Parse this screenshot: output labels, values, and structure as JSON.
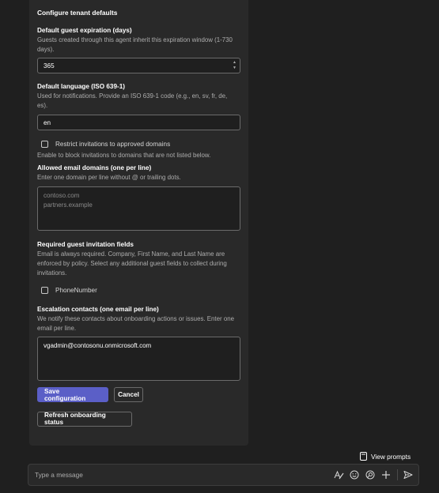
{
  "form": {
    "title": "Configure tenant defaults",
    "expiration": {
      "label": "Default guest expiration (days)",
      "help": "Guests created through this agent inherit this expiration window (1-730 days).",
      "value": "365"
    },
    "language": {
      "label": "Default language (ISO 639-1)",
      "help": "Used for notifications. Provide an ISO 639-1 code (e.g., en, sv, fr, de, es).",
      "value": "en"
    },
    "restrict": {
      "checkbox_label": "Restrict invitations to approved domains",
      "checked": false,
      "help": "Enable to block invitations to domains that are not listed below."
    },
    "domains": {
      "label": "Allowed email domains (one per line)",
      "help": "Enter one domain per line without @ or trailing dots.",
      "placeholder_line1": "contoso.com",
      "placeholder_line2": "partners.example"
    },
    "required_fields": {
      "label": "Required guest invitation fields",
      "help": "Email is always required. Company, First Name, and Last Name are enforced by policy. Select any additional guest fields to collect during invitations.",
      "option_label": "PhoneNumber",
      "checked": false
    },
    "escalation": {
      "label": "Escalation contacts (one email per line)",
      "help": "We notify these contacts about onboarding actions or issues. Enter one email per line.",
      "value": "vgadmin@contosonu.onmicrosoft.com"
    },
    "buttons": {
      "save": "Save configuration",
      "cancel": "Cancel",
      "refresh": "Refresh onboarding status"
    }
  },
  "footer": {
    "view_prompts": "View prompts",
    "message_placeholder": "Type a message"
  },
  "colors": {
    "accent": "#5b5fc7",
    "card_bg": "#292929",
    "page_bg": "#1f1f1f"
  },
  "icons": [
    "prompts-icon",
    "format-icon",
    "emoji-icon",
    "loop-icon",
    "add-icon",
    "send-icon",
    "spinner-up-icon",
    "spinner-down-icon"
  ]
}
